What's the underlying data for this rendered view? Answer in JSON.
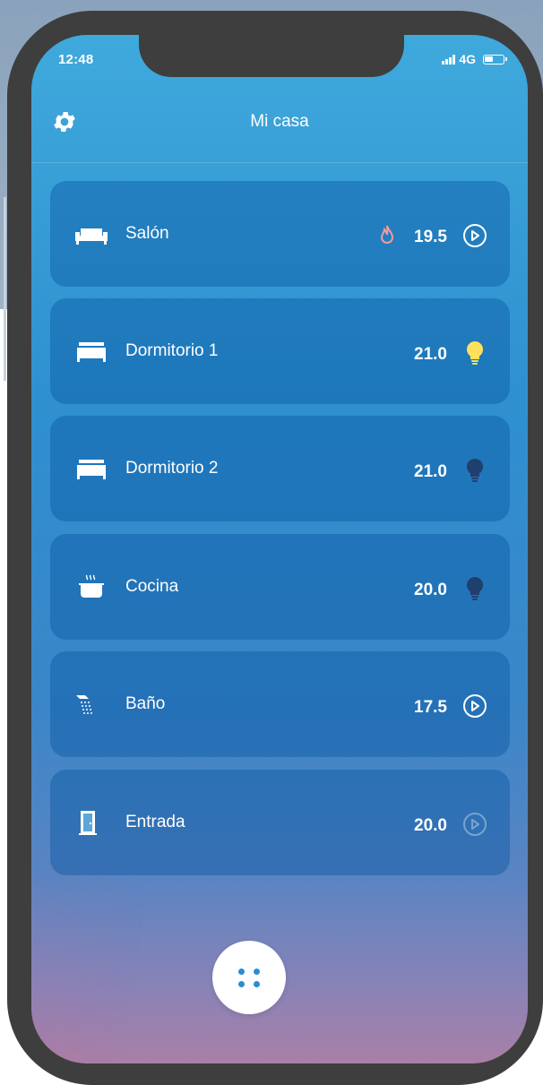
{
  "status_bar": {
    "time": "12:48",
    "network": "4G"
  },
  "header": {
    "title": "Mi casa",
    "settings_icon": "gear-icon"
  },
  "rooms": [
    {
      "name": "Salón",
      "temp": "19.5",
      "icon": "sofa-icon",
      "heating": true,
      "action": "play-circle-icon"
    },
    {
      "name": "Dormitorio 1",
      "temp": "21.0",
      "icon": "bed-icon",
      "heating": false,
      "action": "bulb-on-icon"
    },
    {
      "name": "Dormitorio 2",
      "temp": "21.0",
      "icon": "bed-icon",
      "heating": false,
      "action": "bulb-off-icon"
    },
    {
      "name": "Cocina",
      "temp": "20.0",
      "icon": "pot-icon",
      "heating": false,
      "action": "bulb-off-icon"
    },
    {
      "name": "Baño",
      "temp": "17.5",
      "icon": "shower-icon",
      "heating": false,
      "action": "play-circle-icon"
    },
    {
      "name": "Entrada",
      "temp": "20.0",
      "icon": "door-icon",
      "heating": false,
      "action": "play-circle-dim-icon"
    }
  ],
  "colors": {
    "bulb_on": "#fde15a",
    "bulb_off": "#1f3f6e",
    "flame": "#f49aa0",
    "fab_dots": "#2d8bd0"
  }
}
